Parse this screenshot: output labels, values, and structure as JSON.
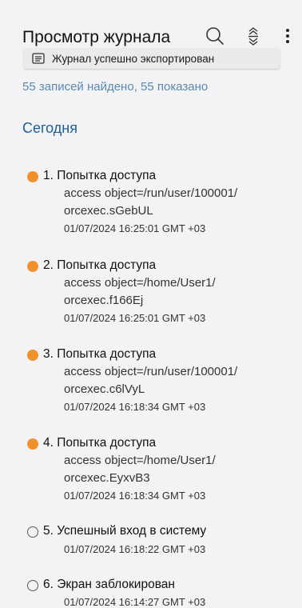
{
  "header": {
    "title": "Просмотр журнала",
    "search_icon": "search-icon",
    "collapse_icon": "collapse-all-icon",
    "menu_icon": "more-vert-icon"
  },
  "toast": {
    "icon": "document-icon",
    "text": "Журнал успешно экспортирован"
  },
  "summary": "55 записей найдено, 55 показано",
  "section_label": "Сегодня",
  "colors": {
    "warning_dot": "#f0922b",
    "section": "#1f5f96",
    "summary": "#5b89b0"
  },
  "entries": [
    {
      "title": "1. Попытка доступа",
      "detail_line1": "access object=/run/user/100001/",
      "detail_line2": "orcexec.sGebUL",
      "time": "01/07/2024 16:25:01 GMT +03",
      "status": "warning"
    },
    {
      "title": "2. Попытка доступа",
      "detail_line1": "access object=/home/User1/",
      "detail_line2": "orcexec.f166Ej",
      "time": "01/07/2024 16:25:01 GMT +03",
      "status": "warning"
    },
    {
      "title": "3. Попытка доступа",
      "detail_line1": "access object=/run/user/100001/",
      "detail_line2": "orcexec.c6lVyL",
      "time": "01/07/2024 16:18:34 GMT +03",
      "status": "warning"
    },
    {
      "title": "4. Попытка доступа",
      "detail_line1": "access object=/home/User1/",
      "detail_line2": "orcexec.EyxvB3",
      "time": "01/07/2024 16:18:34 GMT +03",
      "status": "warning"
    },
    {
      "title": "5. Успешный вход в систему",
      "time": "01/07/2024 16:18:22 GMT +03",
      "status": "info"
    },
    {
      "title": "6. Экран заблокирован",
      "time": "01/07/2024 16:14:27 GMT +03",
      "status": "info"
    }
  ]
}
